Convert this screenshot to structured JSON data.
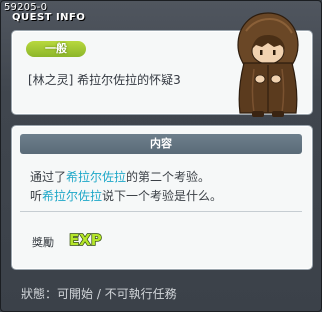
{
  "window": {
    "quest_id": "59205-0",
    "title": "QUEST INFO"
  },
  "quest": {
    "category": "一般",
    "name": "[林之灵] 希拉尔佐拉的怀疑3"
  },
  "content": {
    "header": "内容",
    "line1": {
      "prefix": "通过了",
      "highlight": "希拉尔佐拉",
      "suffix": "的第二个考验。"
    },
    "line2": {
      "prefix": "听",
      "highlight": "希拉尔佐拉",
      "suffix": "说下一个考验是什么。"
    }
  },
  "reward": {
    "label": "獎勵",
    "icon": "exp-icon",
    "icon_text": "EXP"
  },
  "status": {
    "text": "狀態：可開始 / 不可執行任務"
  },
  "colors": {
    "badge_green": "#9cc534",
    "highlight_cyan": "#1fa8c8",
    "header_slate": "#62737f"
  }
}
